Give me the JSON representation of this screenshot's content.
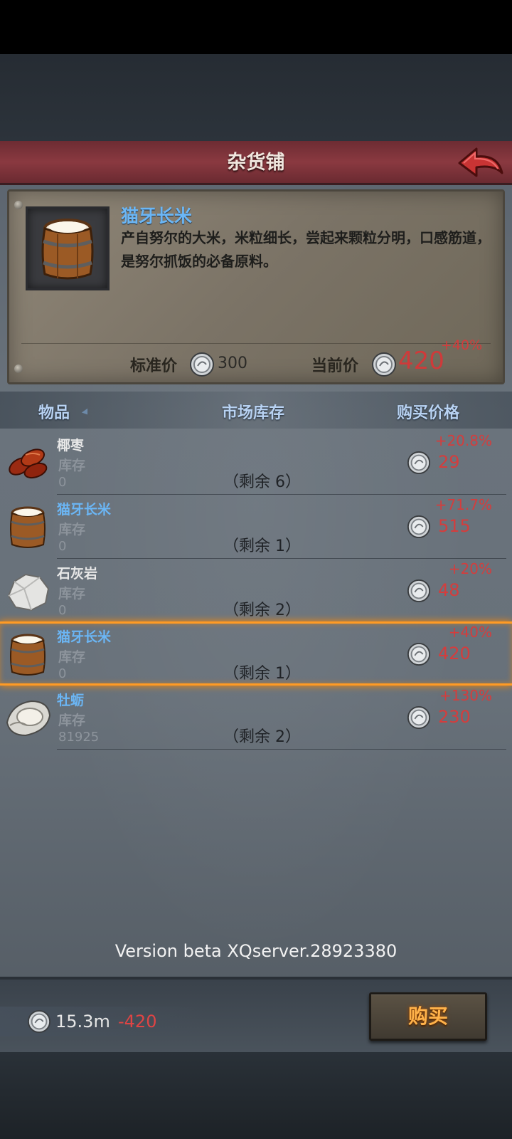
{
  "header": {
    "title": "杂货铺"
  },
  "detail": {
    "name": "猫牙长米",
    "description": "产自努尔的大米，米粒细长，尝起来颗粒分明，口感筋道，是努尔抓饭的必备原料。",
    "standard_price_label": "标准价",
    "standard_price": "300",
    "current_price_label": "当前价",
    "current_price": "420",
    "current_pct": "+40%"
  },
  "columns": {
    "item": "物品",
    "stock": "市场库存",
    "price": "购买价格"
  },
  "rows": [
    {
      "name": "椰枣",
      "stock_label": "库存",
      "stock": "0",
      "remain": "（剩余 6）",
      "pct": "+20.8%",
      "price": "29",
      "icon": "dates-icon",
      "name_color": "#e8e8e8"
    },
    {
      "name": "猫牙长米",
      "stock_label": "库存",
      "stock": "0",
      "remain": "（剩余 1）",
      "pct": "+71.7%",
      "price": "515",
      "icon": "rice-barrel-icon",
      "name_color": "#6bb6f5"
    },
    {
      "name": "石灰岩",
      "stock_label": "库存",
      "stock": "0",
      "remain": "（剩余 2）",
      "pct": "+20%",
      "price": "48",
      "icon": "limestone-icon",
      "name_color": "#e8e8e8"
    },
    {
      "name": "猫牙长米",
      "stock_label": "库存",
      "stock": "0",
      "remain": "（剩余 1）",
      "pct": "+40%",
      "price": "420",
      "icon": "rice-barrel-icon",
      "name_color": "#6bb6f5",
      "selected": true
    },
    {
      "name": "牡蛎",
      "stock_label": "库存",
      "stock": "81925",
      "remain": "（剩余 2）",
      "pct": "+130%",
      "price": "230",
      "icon": "oyster-icon",
      "name_color": "#6bb6f5"
    }
  ],
  "footer": {
    "version": "Version beta XQserver.28923380",
    "money": "15.3m",
    "money_delta": "-420",
    "buy_label": "购买"
  },
  "colors": {
    "price_red": "#d43d3d",
    "highlight": "#ff9b25",
    "rare_blue": "#6bb6f5"
  }
}
